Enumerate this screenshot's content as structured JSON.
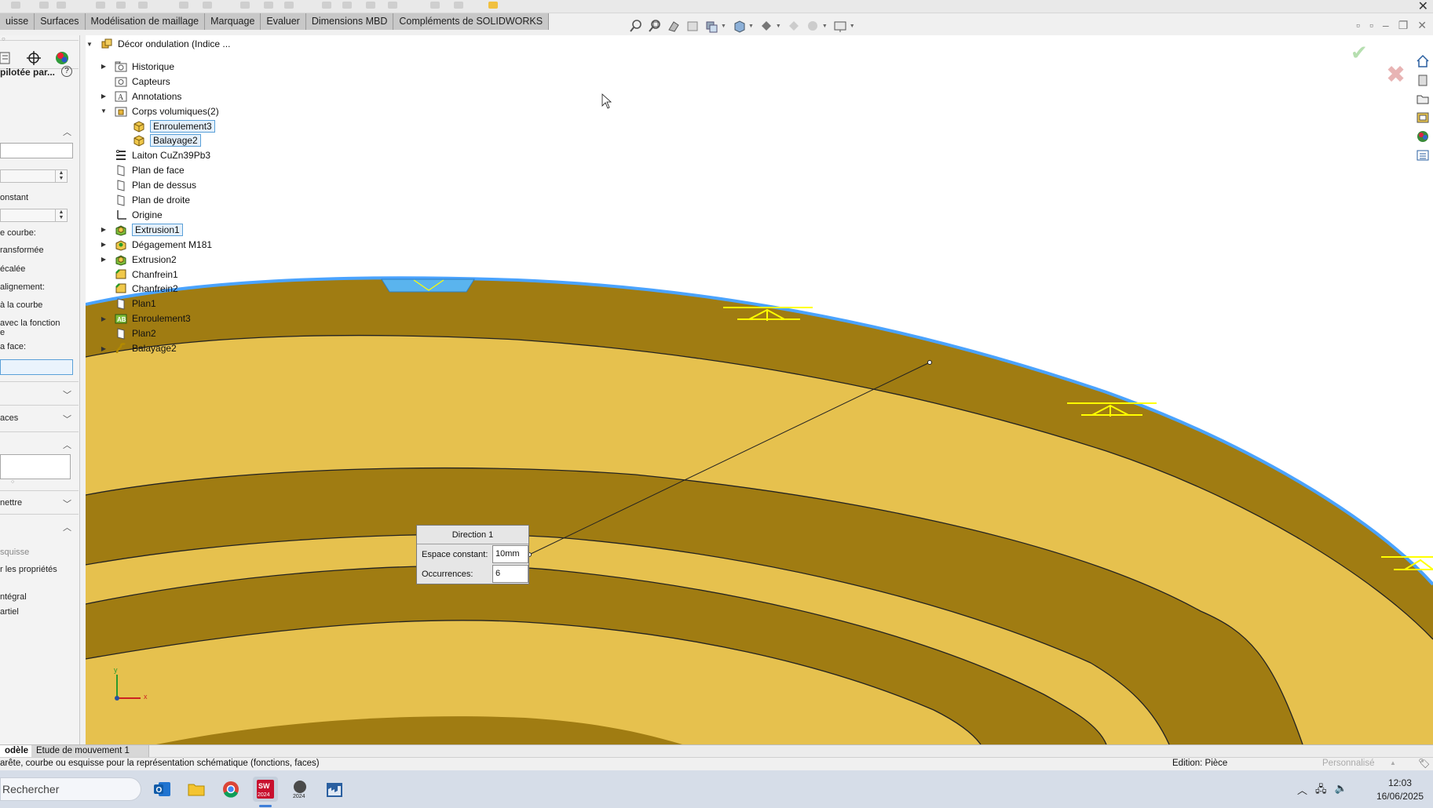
{
  "command_tabs": [
    "uisse",
    "Surfaces",
    "Modélisation de maillage",
    "Marquage",
    "Evaluer",
    "Dimensions MBD",
    "Compléments de SOLIDWORKS"
  ],
  "property_manager": {
    "title": "pilotée par...",
    "help_icon": "question-icon",
    "label_constant": "onstant",
    "label_curve": "e courbe:",
    "label_transformed": "ransformée",
    "label_offset": "écalée",
    "label_alignment": "alignement:",
    "label_to_curve": "à la courbe",
    "label_with_function": "avec la fonction",
    "label_e": "e",
    "label_face": "a face:",
    "label_faces": "aces",
    "label_permettre": "nettre",
    "label_esquisse": "squisse",
    "label_properties": "r les propriétés",
    "label_integral": "ntégral",
    "label_partial": "artiel"
  },
  "tree": {
    "root": "Décor ondulation  (Indice ...",
    "items": [
      {
        "label": "Historique",
        "icon": "history-folder-icon",
        "expandable": true,
        "indent": 1
      },
      {
        "label": "Capteurs",
        "icon": "sensor-icon",
        "expandable": false,
        "indent": 1
      },
      {
        "label": "Annotations",
        "icon": "annotation-icon",
        "expandable": true,
        "indent": 1
      },
      {
        "label": "Corps volumiques(2)",
        "icon": "solid-bodies-folder-icon",
        "expandable": true,
        "expanded": true,
        "indent": 1
      },
      {
        "label": "Enroulement3",
        "icon": "solid-body-icon",
        "expandable": false,
        "indent": 2,
        "selected": true
      },
      {
        "label": "Balayage2",
        "icon": "solid-body-icon",
        "expandable": false,
        "indent": 2,
        "selected": true
      },
      {
        "label": "Laiton CuZn39Pb3",
        "icon": "material-icon",
        "expandable": false,
        "indent": 1
      },
      {
        "label": "Plan de face",
        "icon": "plane-icon",
        "expandable": false,
        "indent": 1
      },
      {
        "label": "Plan de dessus",
        "icon": "plane-icon",
        "expandable": false,
        "indent": 1
      },
      {
        "label": "Plan de droite",
        "icon": "plane-icon",
        "expandable": false,
        "indent": 1
      },
      {
        "label": "Origine",
        "icon": "origin-icon",
        "expandable": false,
        "indent": 1
      },
      {
        "label": "Extrusion1",
        "icon": "extrude-icon",
        "expandable": true,
        "indent": 1,
        "selected": true
      },
      {
        "label": "Dégagement M181",
        "icon": "hole-icon",
        "expandable": true,
        "indent": 1
      },
      {
        "label": "Extrusion2",
        "icon": "extrude-icon",
        "expandable": true,
        "indent": 1
      },
      {
        "label": "Chanfrein1",
        "icon": "chamfer-icon",
        "expandable": false,
        "indent": 1
      },
      {
        "label": "Chanfrein2",
        "icon": "chamfer-icon",
        "expandable": false,
        "indent": 1
      },
      {
        "label": "Plan1",
        "icon": "plane-icon",
        "expandable": false,
        "indent": 1
      },
      {
        "label": "Enroulement3",
        "icon": "wrap-icon",
        "expandable": true,
        "indent": 1
      },
      {
        "label": "Plan2",
        "icon": "plane-icon",
        "expandable": false,
        "indent": 1
      },
      {
        "label": "Balayage2",
        "icon": "sweep-icon",
        "expandable": true,
        "indent": 1
      }
    ]
  },
  "callout": {
    "title": "Direction 1",
    "spacing_label": "Espace constant:",
    "spacing_value": "10mm",
    "occurrences_label": "Occurrences:",
    "occurrences_value": "6"
  },
  "bottom_tabs": {
    "model": "odèle",
    "motion": "Etude de mouvement 1"
  },
  "status_bar": {
    "message": "arête, courbe ou esquisse pour la représentation schématique (fonctions, faces)",
    "mode": "Edition: Pièce",
    "custom": "Personnalisé"
  },
  "taskbar": {
    "search_placeholder": "Rechercher",
    "apps": [
      "outlook-icon",
      "file-explorer-icon",
      "chrome-icon",
      "solidworks-2024-icon",
      "solidworks-2024-alt-icon",
      "factory-app-icon"
    ],
    "time": "12:03",
    "date": "16/06/2025"
  },
  "colors": {
    "part_light": "#e6c14e",
    "part_dark": "#a07c12",
    "edge_highlight": "#4aa3ff",
    "feature_yellow": "#ffff00"
  }
}
